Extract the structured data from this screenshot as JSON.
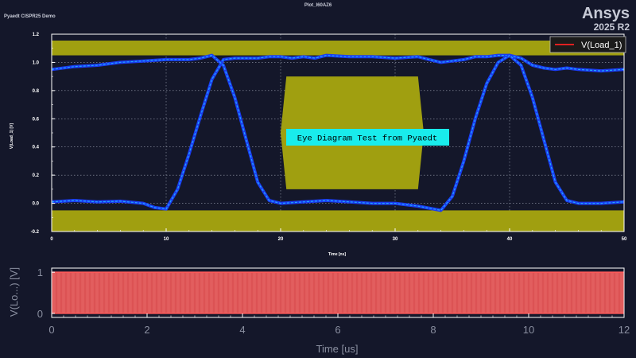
{
  "header": {
    "plot_title": "Plot_I60AZ6",
    "design_name": "Pyaedt CISPR25 Demo",
    "brand": "Ansys",
    "version": "2025 R2"
  },
  "colors": {
    "background": "#14172a",
    "mask": "#a09f10",
    "eye_trace": "#1a3cf0",
    "eye_highlight": "#20a8ff",
    "legend_line": "#e02020",
    "annotation_bg": "#19ecec",
    "transient_trace": "#e84848"
  },
  "chart_data": [
    {
      "type": "line",
      "name": "eye-diagram",
      "xlabel": "Time [ns]",
      "ylabel": "V(Load_1) [V]",
      "xlim": [
        0,
        50
      ],
      "ylim": [
        -0.2,
        1.2
      ],
      "x_ticks": [
        "0",
        "10",
        "20",
        "30",
        "40",
        "50"
      ],
      "y_ticks": [
        "-0.2",
        "0.0",
        "0.2",
        "0.4",
        "0.6",
        "0.8",
        "1.0",
        "1.2"
      ],
      "grid": true,
      "legend": {
        "position": "top-right",
        "entries": [
          "V(Load_1)"
        ]
      },
      "annotation": "Eye Diagram Test from Pyaedt",
      "mask": {
        "upper_band": [
          1.05,
          1.2
        ],
        "lower_band": [
          -0.2,
          -0.05
        ],
        "center_polygon": [
          [
            20,
            0.5
          ],
          [
            20.5,
            0.9
          ],
          [
            32,
            0.9
          ],
          [
            32.5,
            0.5
          ],
          [
            32,
            0.1
          ],
          [
            20.5,
            0.1
          ]
        ]
      },
      "series": [
        {
          "name": "V(Load_1)",
          "x": [
            0,
            2,
            4,
            6,
            8,
            9,
            10,
            11,
            12,
            13,
            14,
            15,
            16,
            17,
            18,
            19,
            20,
            21,
            22,
            23,
            24,
            26,
            28,
            30,
            32,
            33,
            34,
            35,
            36,
            37,
            38,
            39,
            40,
            41,
            42,
            43,
            44,
            45,
            46,
            48,
            50
          ],
          "y": [
            0.01,
            0.02,
            0.01,
            0.015,
            0.0,
            -0.03,
            -0.04,
            0.1,
            0.35,
            0.62,
            0.88,
            1.02,
            1.03,
            1.03,
            1.03,
            1.04,
            1.04,
            1.03,
            1.04,
            1.03,
            1.05,
            1.04,
            1.04,
            1.03,
            1.04,
            1.02,
            1.0,
            1.01,
            1.02,
            1.04,
            1.04,
            1.05,
            1.05,
            1.03,
            0.98,
            0.96,
            0.95,
            0.96,
            0.95,
            0.94,
            0.95
          ]
        },
        {
          "name": "V(Load_1) (falling)",
          "x": [
            0,
            2,
            4,
            6,
            8,
            10,
            12,
            13,
            14,
            15,
            16,
            17,
            18,
            19,
            20,
            22,
            24,
            26,
            28,
            30,
            32,
            34,
            35,
            36,
            37,
            38,
            39,
            40,
            41,
            42,
            43,
            44,
            45,
            46,
            48,
            50
          ],
          "y": [
            0.95,
            0.97,
            0.98,
            1.0,
            1.01,
            1.02,
            1.02,
            1.03,
            1.05,
            0.98,
            0.75,
            0.45,
            0.15,
            0.02,
            0.0,
            0.01,
            0.02,
            0.01,
            0.0,
            0.0,
            -0.02,
            -0.05,
            0.05,
            0.3,
            0.6,
            0.85,
            1.0,
            1.05,
            0.98,
            0.75,
            0.45,
            0.15,
            0.02,
            0.0,
            0.0,
            0.01
          ]
        }
      ]
    },
    {
      "type": "line",
      "name": "transient",
      "xlabel": "Time [us]",
      "ylabel": "V(Lo...) [V]",
      "xlim": [
        0,
        12
      ],
      "ylim": [
        -0.1,
        1.1
      ],
      "x_ticks": [
        "0",
        "2",
        "4",
        "6",
        "8",
        "10",
        "12"
      ],
      "y_ticks": [
        "0",
        "1"
      ],
      "grid": false,
      "series": [
        {
          "name": "V(Load_1)",
          "x": [
            0,
            12
          ],
          "y_low": 0,
          "y_high": 1,
          "pattern": "dense square-wave toggling between 0 and 1 across full range"
        }
      ]
    }
  ]
}
